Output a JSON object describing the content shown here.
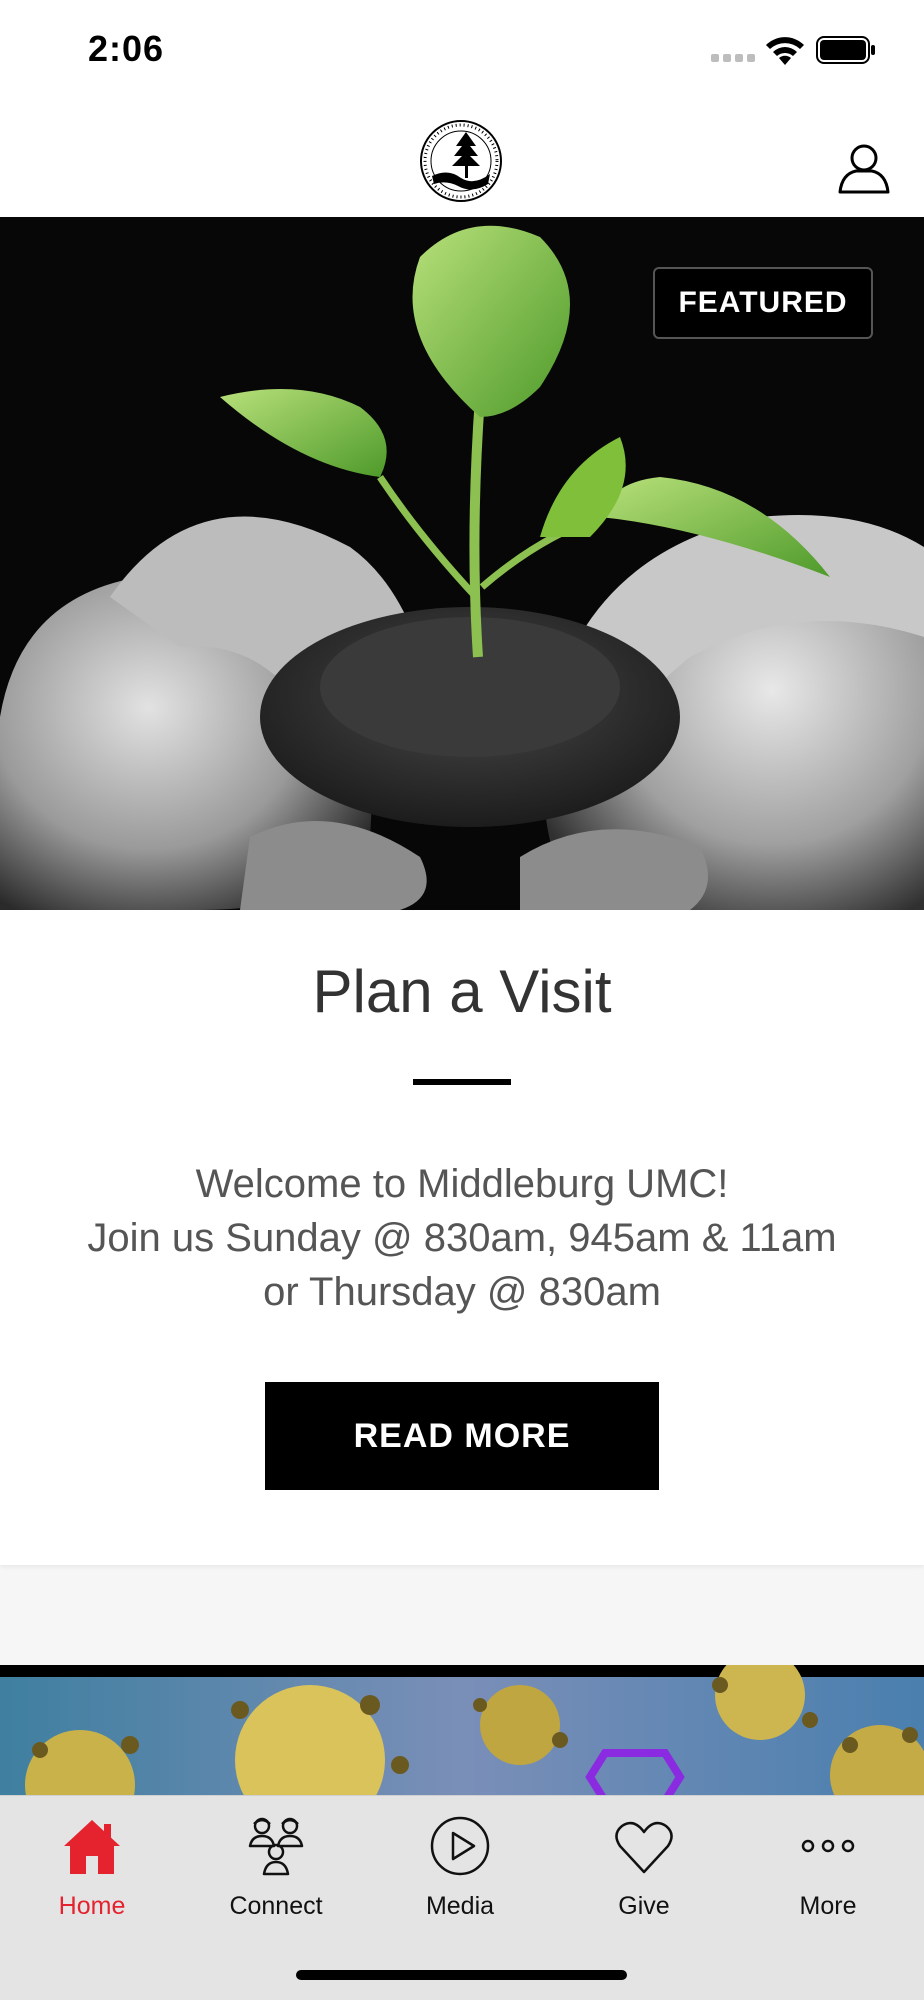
{
  "status_bar": {
    "time": "2:06"
  },
  "header": {
    "logo_icon": "church-logo-icon",
    "profile_icon": "profile-icon"
  },
  "featured_card": {
    "badge": "FEATURED",
    "title": "Plan a Visit",
    "body_lines": [
      "Welcome to Middleburg UMC!",
      "Join us Sunday @ 830am, 945am & 11am",
      "or Thursday @ 830am"
    ],
    "button_label": "READ MORE"
  },
  "tabs": [
    {
      "label": "Home",
      "icon": "home-icon",
      "active": true
    },
    {
      "label": "Connect",
      "icon": "connect-people-icon",
      "active": false
    },
    {
      "label": "Media",
      "icon": "play-icon",
      "active": false
    },
    {
      "label": "Give",
      "icon": "heart-icon",
      "active": false
    },
    {
      "label": "More",
      "icon": "more-dots-icon",
      "active": false
    }
  ],
  "colors": {
    "accent": "#e4232f",
    "tab_bar_bg": "#e4e4e4",
    "button_bg": "#000000"
  }
}
